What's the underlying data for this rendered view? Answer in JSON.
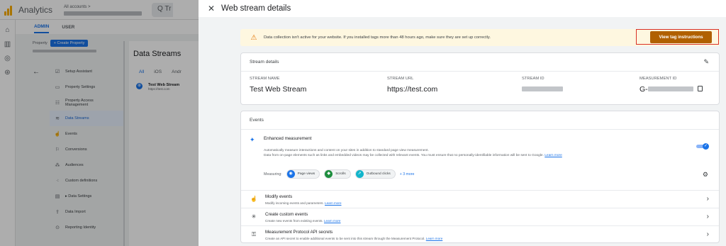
{
  "app": {
    "name": "Analytics",
    "account_label": "All accounts >",
    "search_partial": "Q Tr"
  },
  "admin_tabs": [
    {
      "label": "ADMIN"
    },
    {
      "label": "USER"
    }
  ],
  "property": {
    "label": "Property",
    "create_button": "+ Create Property"
  },
  "admin_menu": [
    {
      "label": "Setup Assistant",
      "icon": "check-box-icon"
    },
    {
      "label": "Property Settings",
      "icon": "settings-page-icon"
    },
    {
      "label": "Property Access Management",
      "icon": "people-icon"
    },
    {
      "label": "Data Streams",
      "icon": "streams-icon"
    },
    {
      "label": "Events",
      "icon": "events-icon"
    },
    {
      "label": "Conversions",
      "icon": "flag-icon"
    },
    {
      "label": "Audiences",
      "icon": "audiences-icon"
    },
    {
      "label": "Custom definitions",
      "icon": "custom-defs-icon"
    },
    {
      "label": "▸ Data Settings",
      "icon": "database-icon"
    },
    {
      "label": "Data Import",
      "icon": "upload-icon"
    },
    {
      "label": "Reporting Identity",
      "icon": "identity-icon"
    }
  ],
  "data_streams": {
    "title": "Data Streams",
    "tabs": [
      "All",
      "iOS",
      "Andr"
    ],
    "stream_name": "Test Web Stream",
    "stream_url": "https://test.com"
  },
  "panel": {
    "title": "Web stream details",
    "banner": {
      "text": "Data collection isn't active for your website. If you installed tags more than 48 hours ago, make sure they are set up correctly.",
      "button": "View tag instructions"
    },
    "stream_details": {
      "heading": "Stream details",
      "name_label": "STREAM NAME",
      "name_value": "Test Web Stream",
      "url_label": "STREAM URL",
      "url_value": "https://test.com",
      "id_label": "STREAM ID",
      "mid_label": "MEASUREMENT ID",
      "mid_prefix": "G-"
    },
    "events": {
      "heading": "Events",
      "enhanced": {
        "title": "Enhanced measurement",
        "desc1": "Automatically measure interactions and content on your sites in addition to standard page view measurement.",
        "desc2": "Data from on-page elements such as links and embedded videos may be collected with relevant events. You must ensure that no personally-identifiable information will be sent to Google.",
        "learn_more": "Learn more",
        "measuring_label": "Measuring:",
        "chips": [
          {
            "label": "Page views",
            "color": "#1a73e8"
          },
          {
            "label": "Scrolls",
            "color": "#1e8e3e"
          },
          {
            "label": "Outbound clicks",
            "color": "#12b5cb"
          }
        ],
        "more": "+ 3 more",
        "enabled": true
      },
      "rows": [
        {
          "title": "Modify events",
          "sub": "Modify incoming events and parameters.",
          "link": "Learn more"
        },
        {
          "title": "Create custom events",
          "sub": "Create new events from existing events.",
          "link": "Learn more"
        },
        {
          "title": "Measurement Protocol API secrets",
          "sub": "Create an API secret to enable additional events to be sent into this stream through the Measurement Protocol.",
          "link": "Learn more"
        }
      ]
    }
  },
  "colors": {
    "accent": "#1a73e8",
    "warning_button": "#b06000",
    "banner_bg": "#fef7e0",
    "highlight_box": "#d93025"
  }
}
